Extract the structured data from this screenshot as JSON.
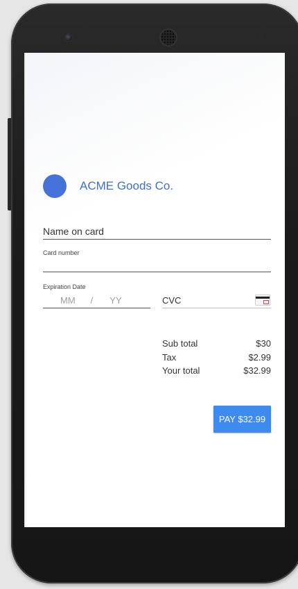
{
  "merchant": {
    "name": "ACME Goods Co.",
    "logo_color": "#4573d9"
  },
  "form": {
    "name_placeholder": "Name on card",
    "card_number_label": "Card number",
    "card_number_value": "",
    "expiration_label": "Expiration Date",
    "exp_month_placeholder": "MM",
    "exp_separator": "/",
    "exp_year_placeholder": "YY",
    "cvc_placeholder": "CVC",
    "cvc_icon": "credit-card-cvc-icon"
  },
  "summary": {
    "rows": [
      {
        "label": "Sub total",
        "value": "$30"
      },
      {
        "label": "Tax",
        "value": "$2.99"
      },
      {
        "label": "Your total",
        "value": "$32.99"
      }
    ]
  },
  "pay_button": {
    "label": "PAY $32.99",
    "color": "#3d8bee"
  }
}
